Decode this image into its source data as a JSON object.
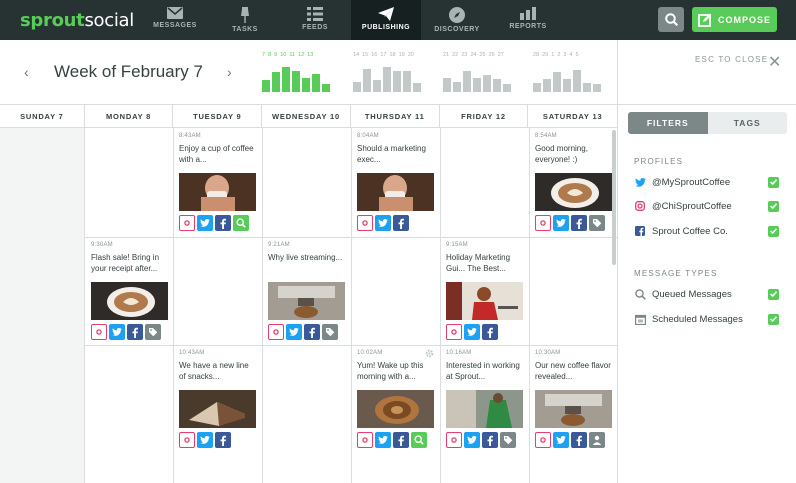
{
  "brand": {
    "part1": "sprout",
    "part2": "social"
  },
  "nav": [
    {
      "label": "MESSAGES"
    },
    {
      "label": "TASKS"
    },
    {
      "label": "FEEDS"
    },
    {
      "label": "PUBLISHING"
    },
    {
      "label": "DISCOVERY"
    },
    {
      "label": "REPORTS"
    }
  ],
  "compose_label": "COMPOSE",
  "week_title": "Week of February 7",
  "sparklines": [
    {
      "days": [
        "7",
        "8",
        "9",
        "10",
        "11",
        "12",
        "13"
      ],
      "heights": [
        0.45,
        0.75,
        0.95,
        0.8,
        0.55,
        0.7,
        0.3
      ],
      "color": "#59cb59"
    },
    {
      "days": [
        "14",
        "15",
        "16",
        "17",
        "18",
        "19",
        "20"
      ],
      "heights": [
        0.4,
        0.9,
        0.45,
        0.95,
        0.8,
        0.8,
        0.35
      ],
      "color": "#c3c8c8"
    },
    {
      "days": [
        "21",
        "22",
        "23",
        "24",
        "25",
        "26",
        "27"
      ],
      "heights": [
        0.55,
        0.4,
        0.8,
        0.55,
        0.65,
        0.5,
        0.3
      ],
      "color": "#c3c8c8"
    },
    {
      "days": [
        "28",
        "29",
        "1",
        "2",
        "3",
        "4",
        "5"
      ],
      "heights": [
        0.35,
        0.5,
        0.75,
        0.5,
        0.85,
        0.35,
        0.3
      ],
      "color": "#c3c8c8"
    }
  ],
  "esc_label": "ESC TO CLOSE",
  "filters": {
    "tab_filters": "FILTERS",
    "tab_tags": "TAGS",
    "profiles_title": "PROFILES",
    "profiles": [
      {
        "label": "@MySproutCoffee",
        "icon": "twitter-icon"
      },
      {
        "label": "@ChiSproutCoffee",
        "icon": "instagram-icon"
      },
      {
        "label": "Sprout Coffee Co.",
        "icon": "facebook-icon"
      }
    ],
    "message_types_title": "MESSAGE TYPES",
    "message_types": [
      {
        "label": "Queued Messages",
        "icon": "queue-icon"
      },
      {
        "label": "Scheduled Messages",
        "icon": "calendar-icon"
      }
    ]
  },
  "day_headers": [
    "SUNDAY 7",
    "MONDAY 8",
    "TUESDAY 9",
    "WEDNESDAY 10",
    "THURSDAY 11",
    "FRIDAY 12",
    "SATURDAY 13"
  ],
  "posts": [
    {
      "time": "8:43AM",
      "text": "Enjoy a cup of coffee with a...",
      "image": "woman-drinking-coffee",
      "icons": [
        "ig",
        "tw",
        "fb",
        "q"
      ]
    },
    {
      "time": "8:04AM",
      "text": "Should a marketing exec...",
      "image": "woman-drinking-coffee",
      "icons": [
        "ig",
        "tw",
        "fb"
      ]
    },
    {
      "time": "8:54AM",
      "text": "Good morning, everyone! :)",
      "image": "latte-art",
      "icons": [
        "ig",
        "tw",
        "fb",
        "tag"
      ]
    },
    {
      "time": "9:30AM",
      "text": "Flash sale! Bring in your receipt after...",
      "image": "latte-art",
      "icons": [
        "ig",
        "tw",
        "fb",
        "tag"
      ]
    },
    {
      "time": "9:21AM",
      "text": "Why live streaming...",
      "image": "espresso-machine",
      "icons": [
        "ig",
        "tw",
        "fb",
        "tag"
      ]
    },
    {
      "time": "9:15AM",
      "text": "Holiday Marketing Gui... The Best...",
      "image": "woman-in-red",
      "icons": [
        "ig",
        "tw",
        "fb"
      ]
    },
    {
      "time": "10:43AM",
      "text": "We have a new line of snacks...",
      "image": "pastry",
      "icons": [
        "ig",
        "tw",
        "fb"
      ]
    },
    {
      "time": "10:02AM",
      "text": "Yum! Wake up this morning with a...",
      "image": "cinnamon-roll",
      "icons": [
        "ig",
        "tw",
        "fb",
        "q"
      ]
    },
    {
      "time": "10:16AM",
      "text": "Interested in working at Sprout...",
      "image": "barista",
      "icons": [
        "ig",
        "tw",
        "fb",
        "tag"
      ]
    },
    {
      "time": "10:30AM",
      "text": "Our new coffee flavor revealed...",
      "image": "espresso-machine",
      "icons": [
        "ig",
        "tw",
        "fb",
        "user"
      ]
    }
  ]
}
